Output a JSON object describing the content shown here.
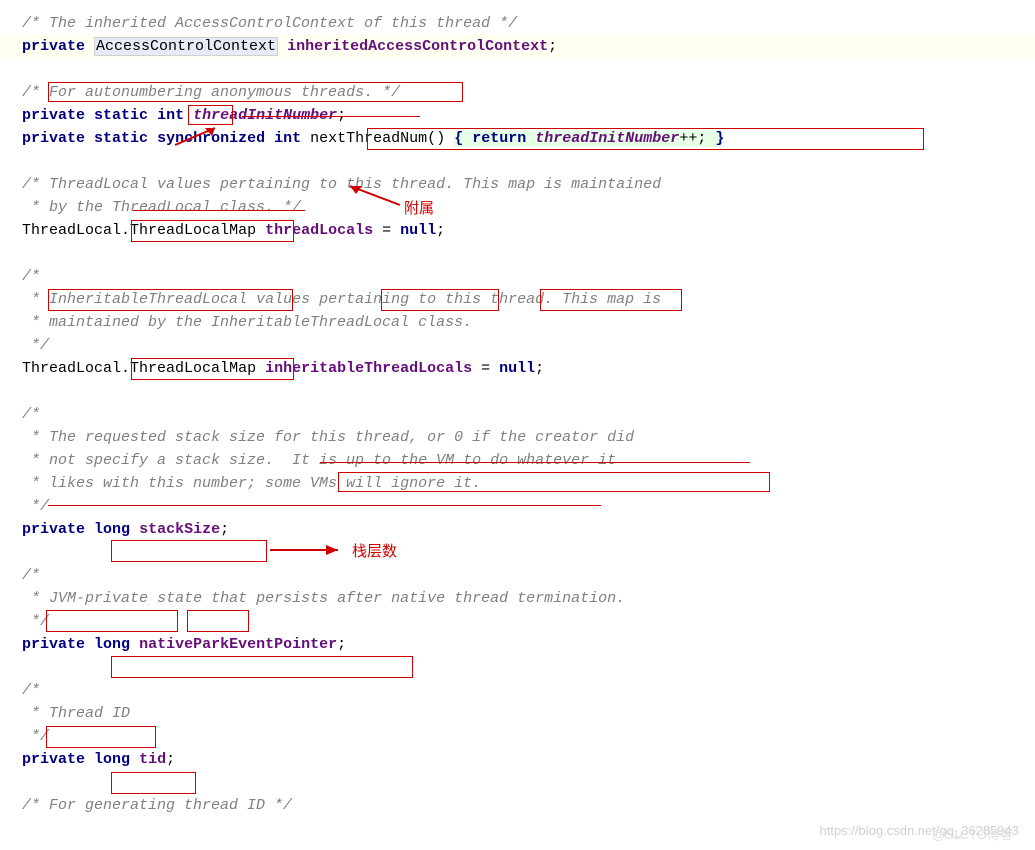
{
  "code": {
    "c1": "/* The inherited AccessControlContext of this thread */",
    "kw_private": "private",
    "kw_static": "static",
    "kw_synchronized": "synchronized",
    "kw_int": "int",
    "kw_long": "long",
    "kw_return": "return",
    "kw_null": "null",
    "type_acc": "AccessControlContext",
    "member_inheritedAcc": "inheritedAccessControlContext",
    "c2a": "/* ",
    "c2b": "For autonumbering anonymous threads.",
    "c2c": " */",
    "member_threadInitNumber": "threadInitNumber",
    "method_nextThreadNum": "nextThreadNum",
    "c3a": "/* ThreadLocal values pertaining to this thread. This map is maintained",
    "c3b": " * by the ThreadLocal class. */",
    "threadlocal": "ThreadLocal",
    "threadlocalmap": "ThreadLocalMap",
    "member_threadLocals": "threadLocals",
    "eqnull": " = ",
    "semi": ";",
    "dot": ".",
    "c4a": "/*",
    "c4b": " * ",
    "c4c": "InheritableThreadLocal",
    "c4d": " values ",
    "c4e": "pertaining",
    "c4f": " to ",
    "c4g": "this thread.",
    "c4h": " This map is",
    "c4i": " * maintained by the InheritableThreadLocal class.",
    "c4j": " */",
    "member_inheritable": "inheritableThreadLocals",
    "c5a": "/*",
    "c5b": " * The requested stack size for this thread, or 0 if the creator did",
    "c5c": " * not specify a stack size.  ",
    "c5d": "It is up to the VM to do whatever it",
    "c5e": " * ",
    "c5f": "likes with this number; some VMs will ignore it.",
    "c5g": " */",
    "member_stackSize": "stackSize",
    "c6a": "/*",
    "c6b": " * ",
    "c6c": "JVM-private",
    "c6d": " ",
    "c6e": "state",
    "c6f": " that persists after native thread termination.",
    "c6g": " */",
    "member_nativePark": "nativeParkEventPointer",
    "c7a": "/*",
    "c7b": " * ",
    "c7c": "Thread ID",
    "c7d": " */",
    "member_tid": "tid",
    "c8": "/* For generating thread ID */",
    "paren_open": "(",
    "paren_close": ")",
    "brace_open": "{",
    "brace_close": "}",
    "plusplus": "++",
    "space": " "
  },
  "annotations": {
    "a1": "附属",
    "a2": "栈层数"
  },
  "watermark": "https://blog.csdn.net/qq_36285943",
  "watermark2": "@51CTO博客"
}
